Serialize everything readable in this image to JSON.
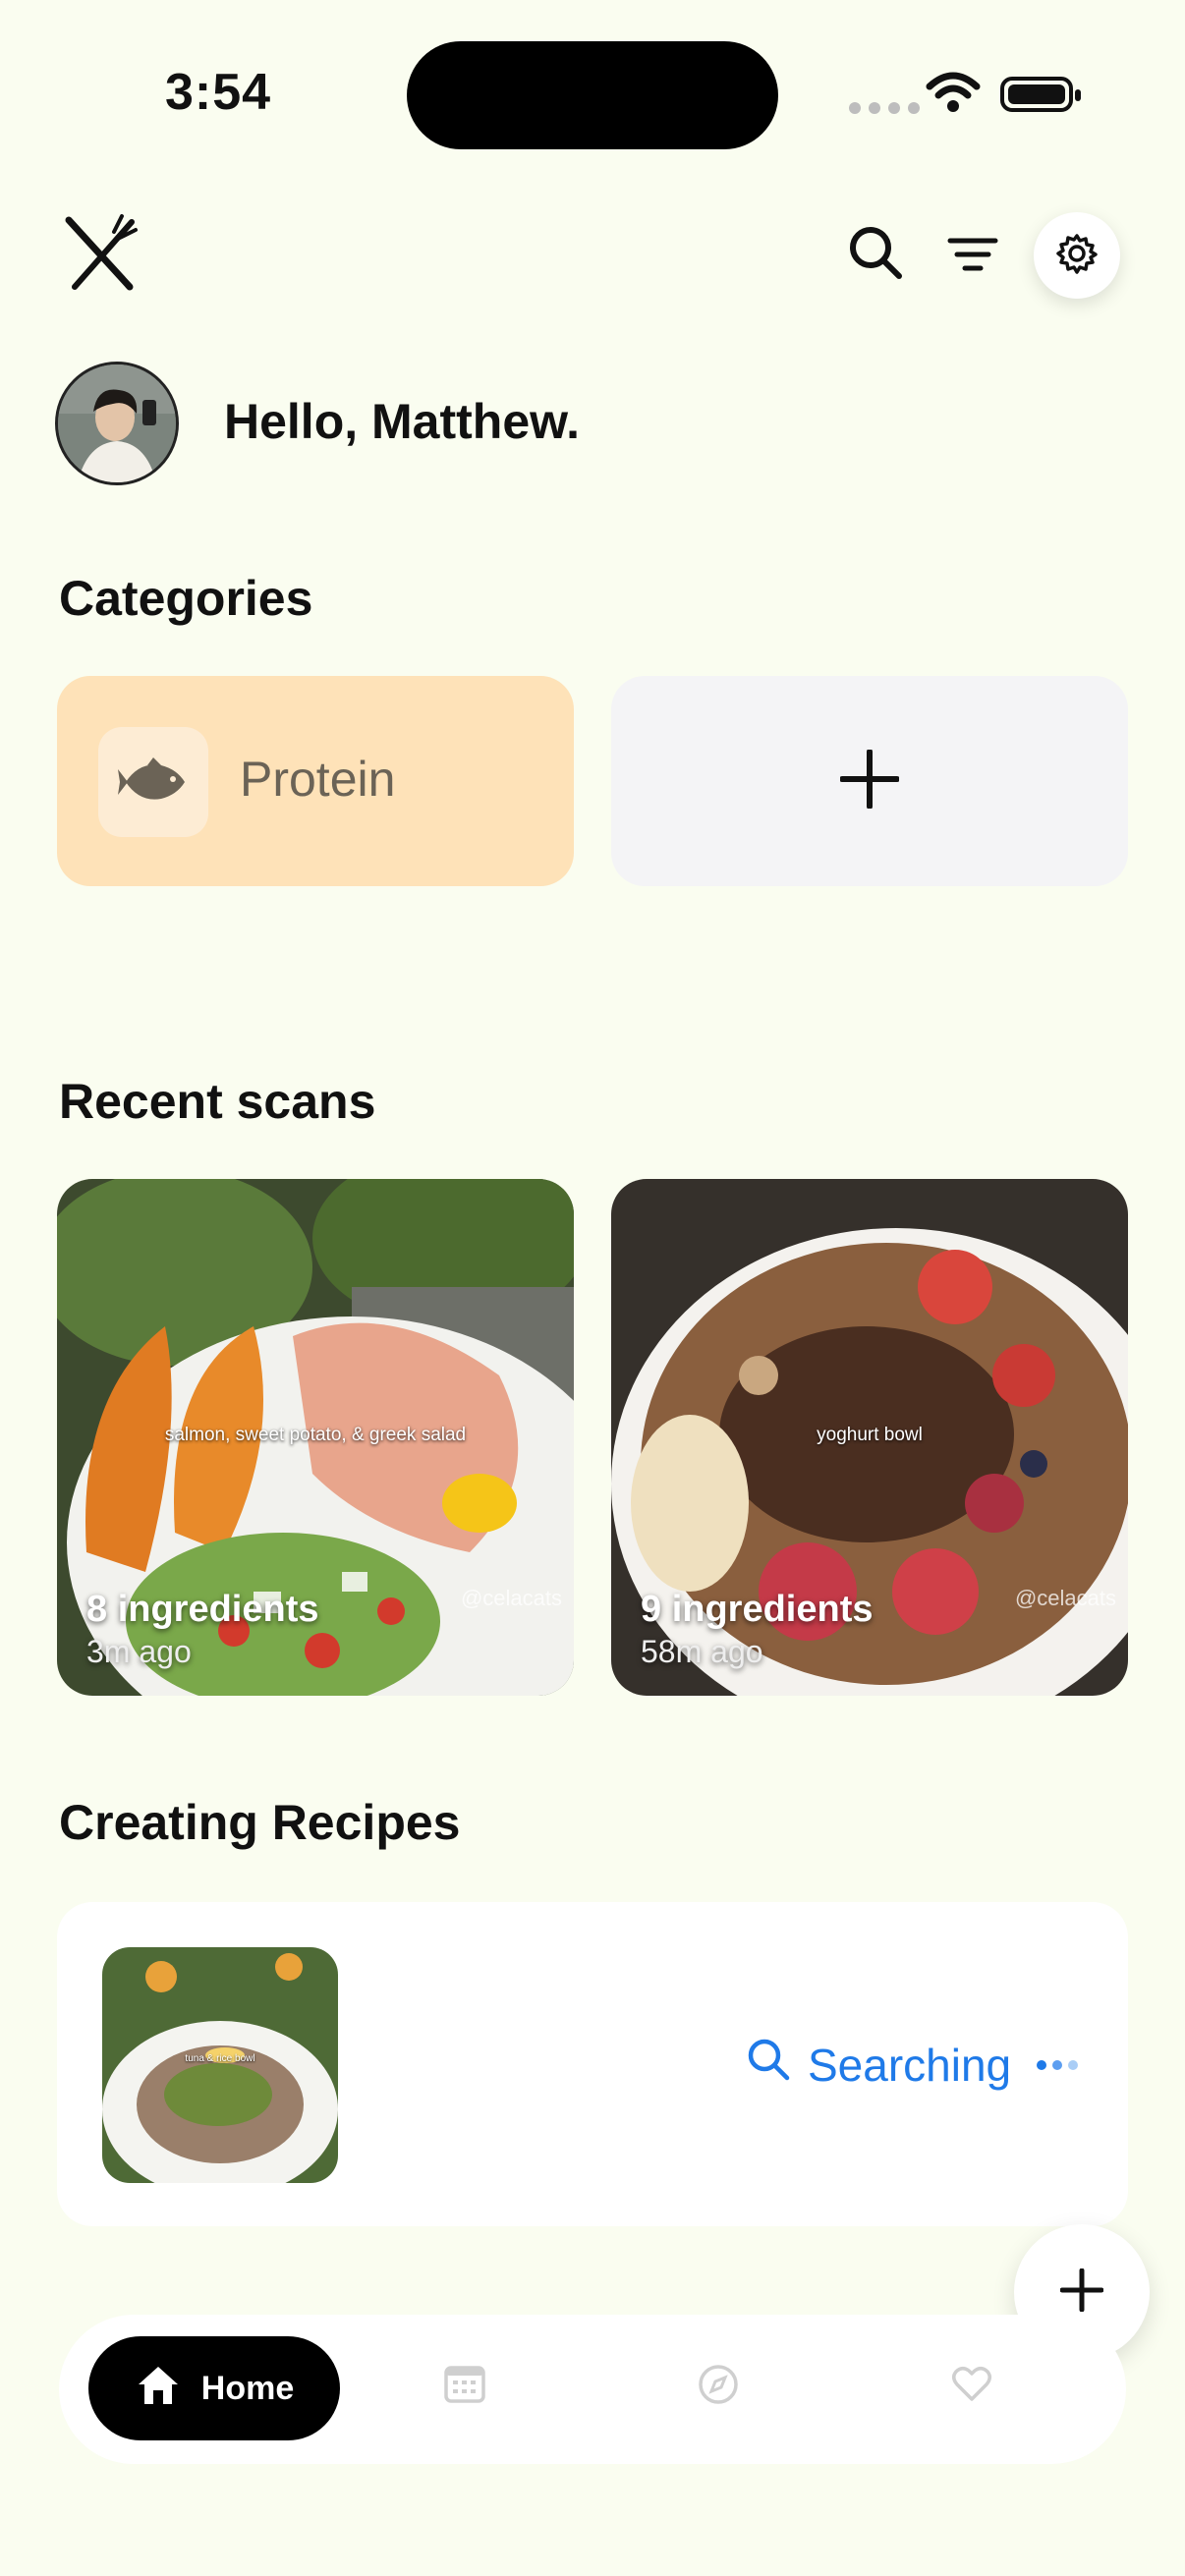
{
  "status_bar": {
    "time": "3:54"
  },
  "greeting": {
    "text": "Hello, Matthew."
  },
  "categories": {
    "title": "Categories",
    "items": [
      {
        "label": "Protein",
        "icon": "fish-icon",
        "color": "#fee2b8"
      }
    ],
    "add_icon": "plus-icon"
  },
  "recent_scans": {
    "title": "Recent scans",
    "items": [
      {
        "ingredients": "8 ingredients",
        "time": "3m ago",
        "caption": "salmon, sweet potato, & greek salad",
        "watermark": "@celacats"
      },
      {
        "ingredients": "9 ingredients",
        "time": "58m ago",
        "caption": "yoghurt bowl",
        "watermark": "@celacats"
      }
    ]
  },
  "creating_recipes": {
    "title": "Creating Recipes",
    "items": [
      {
        "thumb_caption": "tuna & rice bowl",
        "status": "Searching"
      }
    ]
  },
  "nav": {
    "items": [
      {
        "label": "Home",
        "icon": "home-icon",
        "active": true
      },
      {
        "icon": "calendar-icon"
      },
      {
        "icon": "compass-icon"
      },
      {
        "icon": "heart-icon"
      }
    ]
  },
  "colors": {
    "background": "#fafdf0",
    "accent": "#1f7ae8",
    "category": "#fee2b8"
  }
}
